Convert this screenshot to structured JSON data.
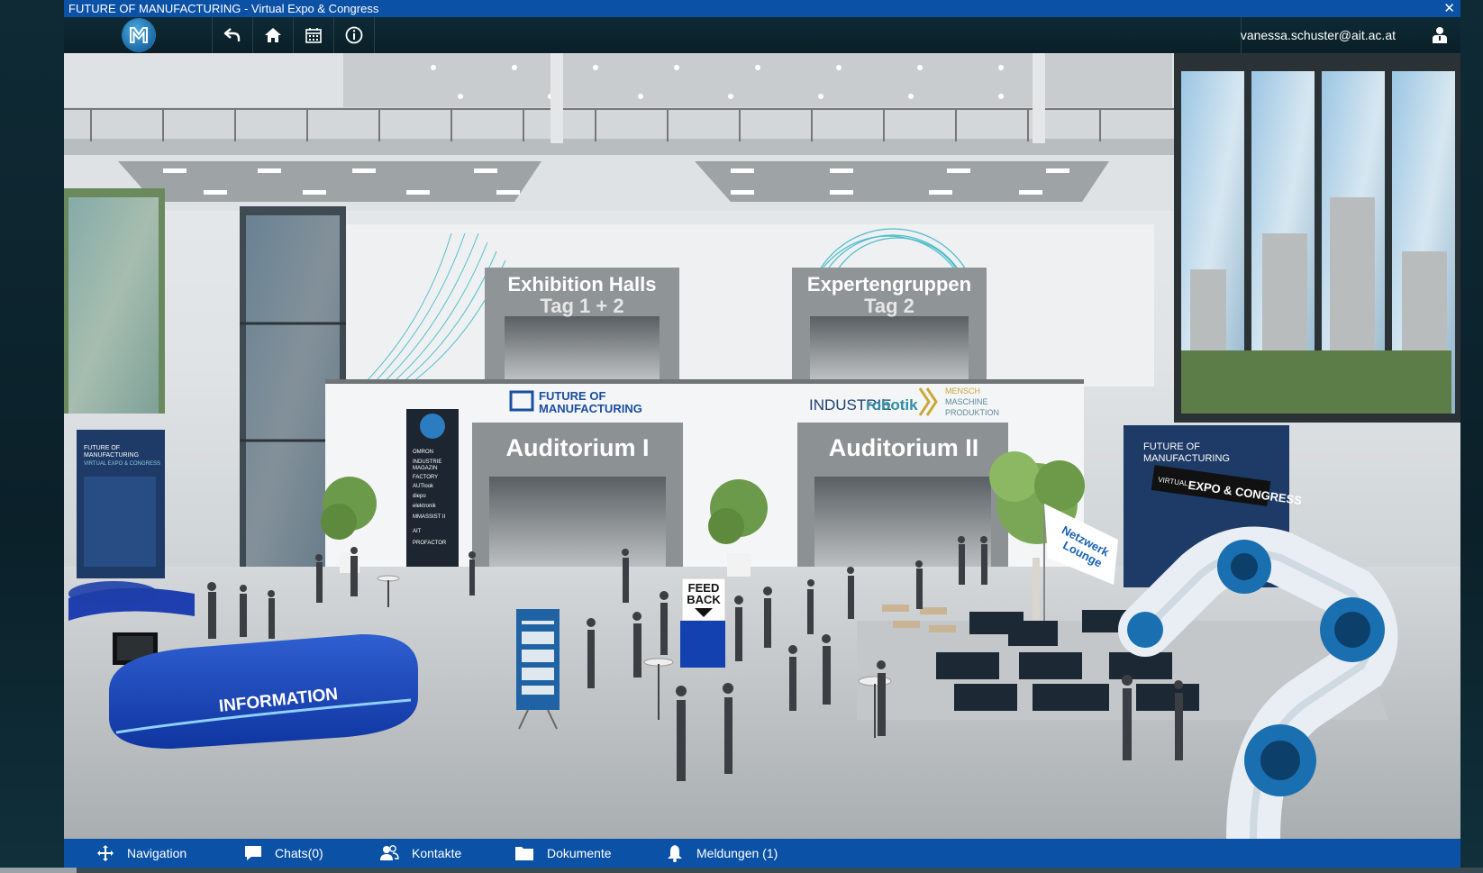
{
  "window": {
    "title": "FUTURE OF MANUFACTURING - Virtual Expo & Congress",
    "close_label": "✕"
  },
  "toolbar": {
    "buttons": [
      {
        "name": "back-icon"
      },
      {
        "name": "home-icon"
      },
      {
        "name": "calendar-icon"
      },
      {
        "name": "info-icon"
      }
    ],
    "user_email": "vanessa.schuster@ait.ac.at",
    "user_icon": "user-icon"
  },
  "scene": {
    "signs": {
      "exhibition": [
        "Exhibition Halls",
        "Tag 1 + 2"
      ],
      "experts": [
        "Expertengruppen",
        "Tag 2"
      ],
      "auditorium1": "Auditorium I",
      "auditorium2": "Auditorium II",
      "feedback": [
        "FEED",
        "BACK"
      ],
      "information": "INFORMATION",
      "lounge": [
        "Netzwerk",
        "Lounge"
      ]
    },
    "logos": {
      "fom": [
        "FUTURE OF",
        "MANUFACTURING"
      ],
      "industrie_a": "INDUSTRIE",
      "industrie_b": "robotik",
      "mmp": [
        "MENSCH",
        "MASCHINE",
        "PRODUKTION"
      ],
      "banner_left": [
        "FUTURE OF",
        "MANUFACTURING",
        "VIRTUAL EXPO & CONGRESS"
      ],
      "banner_right": [
        "FUTURE OF",
        "MANUFACTURING"
      ],
      "banner_right_tag_a": "VIRTUAL",
      "banner_right_tag_b": "EXPO & CONGRESS",
      "sponsors": [
        "OMRON",
        "INDUSTRIE",
        "MAGAZIN",
        "FACTORY",
        "AUTlook",
        "diepo",
        "elektronik",
        "MMASSIST II",
        "AIT",
        "PROFACTOR"
      ]
    }
  },
  "bottom_nav": [
    {
      "label": "Navigation",
      "icon": "navigation-icon"
    },
    {
      "label": "Chats(0)",
      "icon": "chat-icon"
    },
    {
      "label": "Kontakte",
      "icon": "contacts-icon"
    },
    {
      "label": "Dokumente",
      "icon": "folder-icon"
    },
    {
      "label": "Meldungen (1)",
      "icon": "bell-icon"
    }
  ],
  "colors": {
    "brand_blue": "#0b51a6",
    "toolbar_dark": "#0e2a35",
    "counter_blue": "#1746b8"
  }
}
